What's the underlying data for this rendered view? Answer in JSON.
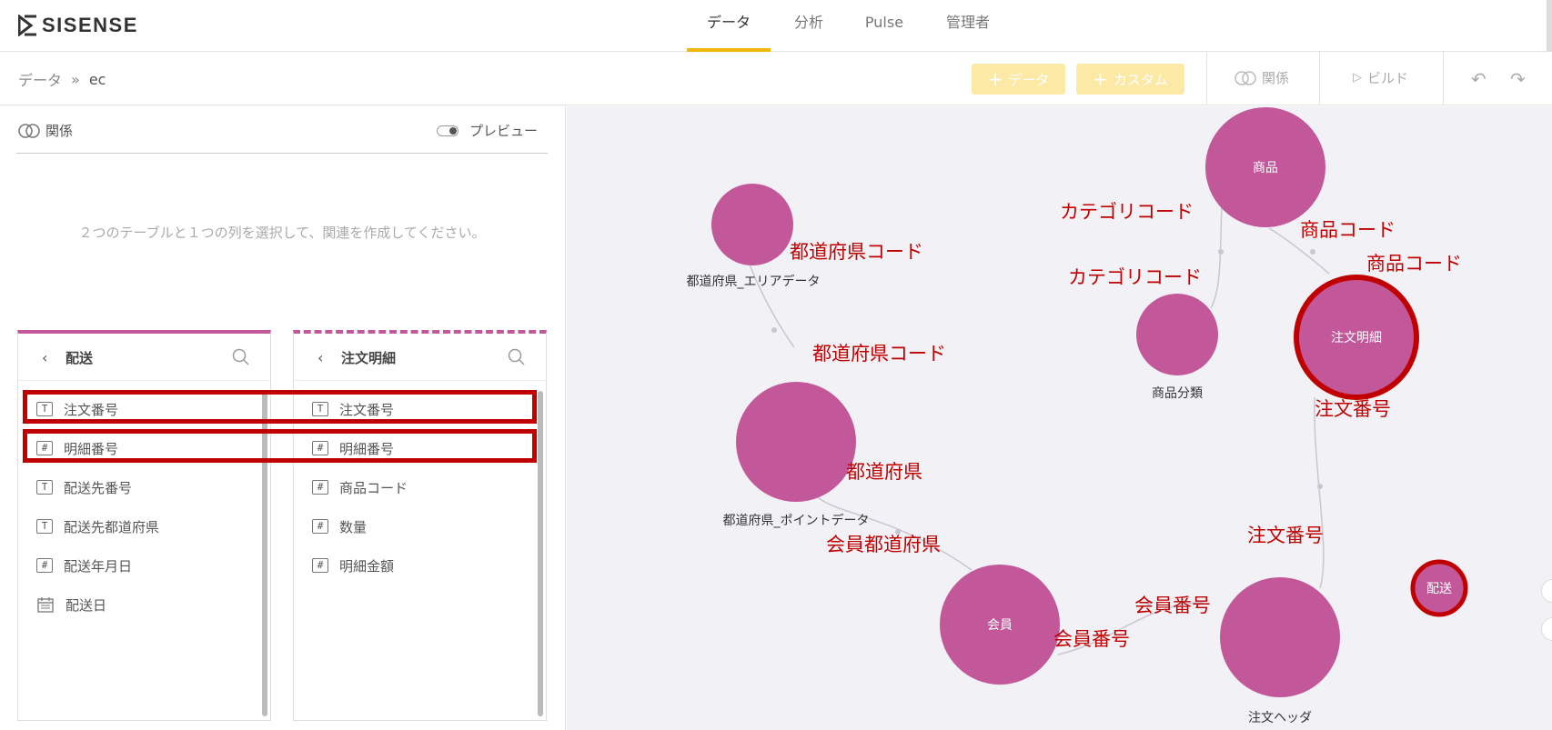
{
  "app": {
    "logo_text": "SISENSE"
  },
  "nav": {
    "tabs": [
      {
        "label": "データ",
        "active": true
      },
      {
        "label": "分析",
        "active": false
      },
      {
        "label": "Pulse",
        "active": false
      },
      {
        "label": "管理者",
        "active": false
      }
    ]
  },
  "breadcrumb": {
    "root": "データ",
    "separator": "»",
    "current": "ec"
  },
  "toolbar": {
    "add_data": "データ",
    "add_custom": "カスタム",
    "relations": "関係",
    "build": "ビルド"
  },
  "relations_panel": {
    "title": "関係",
    "preview_label": "プレビュー",
    "hint": "２つのテーブルと１つの列を選択して、関連を作成してください。"
  },
  "tables": {
    "left": {
      "title": "配送",
      "columns": [
        {
          "icon": "text",
          "name": "注文番号"
        },
        {
          "icon": "number",
          "name": "明細番号"
        },
        {
          "icon": "text",
          "name": "配送先番号"
        },
        {
          "icon": "text",
          "name": "配送先都道府県"
        },
        {
          "icon": "number",
          "name": "配送年月日"
        },
        {
          "icon": "date",
          "name": "配送日"
        }
      ]
    },
    "right": {
      "title": "注文明細",
      "columns": [
        {
          "icon": "text",
          "name": "注文番号"
        },
        {
          "icon": "number",
          "name": "明細番号"
        },
        {
          "icon": "number",
          "name": "商品コード"
        },
        {
          "icon": "number",
          "name": "数量"
        },
        {
          "icon": "number",
          "name": "明細金額"
        }
      ]
    }
  },
  "diagram": {
    "node_color": "#c2589a",
    "highlight_color": "#c00000",
    "nodes": {
      "shohin": "商品",
      "chumon_meisai": "注文明細",
      "area": "都道府県_エリアデータ",
      "bunrui": "商品分類",
      "point": "都道府県_ポイントデータ",
      "kaiin": "会員",
      "header": "注文ヘッダ",
      "haisou": "配送"
    },
    "labels": {
      "category_code_1": "カテゴリコード",
      "category_code_2": "カテゴリコード",
      "product_code_1": "商品コード",
      "product_code_2": "商品コード",
      "pref_code_1": "都道府県コード",
      "pref_code_2": "都道府県コード",
      "order_no_1": "注文番号",
      "order_no_2": "注文番号",
      "pref": "都道府県",
      "member_pref": "会員都道府県",
      "member_no_1": "会員番号",
      "member_no_2": "会員番号"
    }
  }
}
